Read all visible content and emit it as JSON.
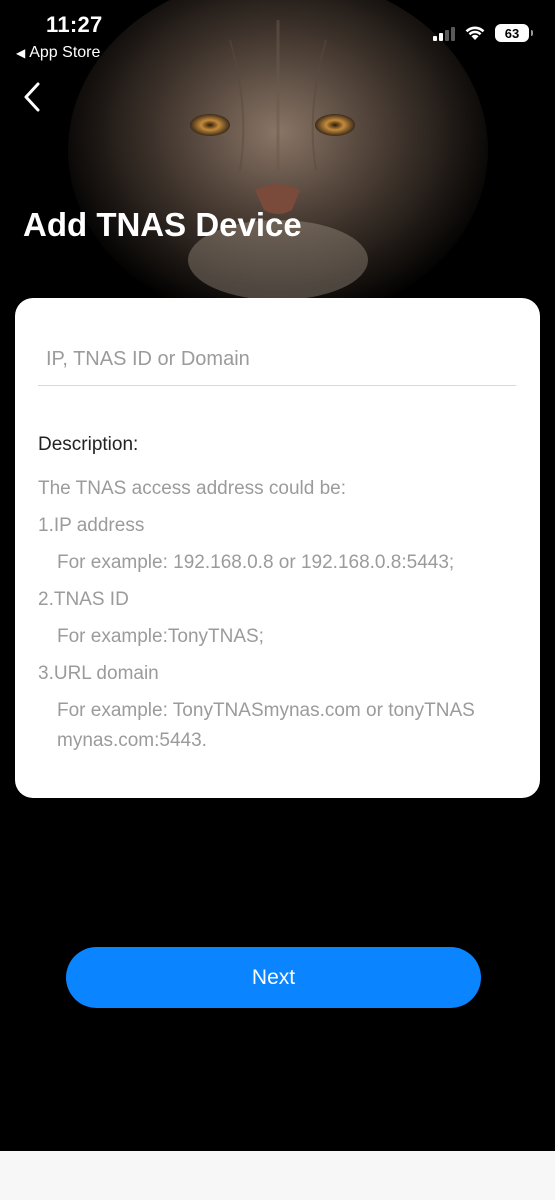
{
  "status_bar": {
    "time": "11:27",
    "back_app": "App Store",
    "back_app_icon": "triangle-left",
    "battery": "63"
  },
  "header": {
    "back_icon": "chevron-left",
    "title": "Add TNAS Device",
    "hero_image": "lynx-face"
  },
  "form": {
    "address_placeholder": "IP, TNAS ID or Domain",
    "address_value": ""
  },
  "description": {
    "title": "Description:",
    "intro": "The TNAS access address could be:",
    "items": [
      {
        "label": "1.IP address",
        "example": "For example: 192.168.0.8 or 192.168.0.8:5443;"
      },
      {
        "label": "2.TNAS ID",
        "example": "For example:TonyTNAS;"
      },
      {
        "label": "3.URL domain",
        "example": "For example: TonyTNASmynas.com or tonyTNAS mynas.com:5443."
      }
    ]
  },
  "actions": {
    "next_label": "Next"
  },
  "colors": {
    "accent": "#0a84ff",
    "background": "#000000",
    "card": "#ffffff",
    "muted_text": "#9b9b9b"
  }
}
